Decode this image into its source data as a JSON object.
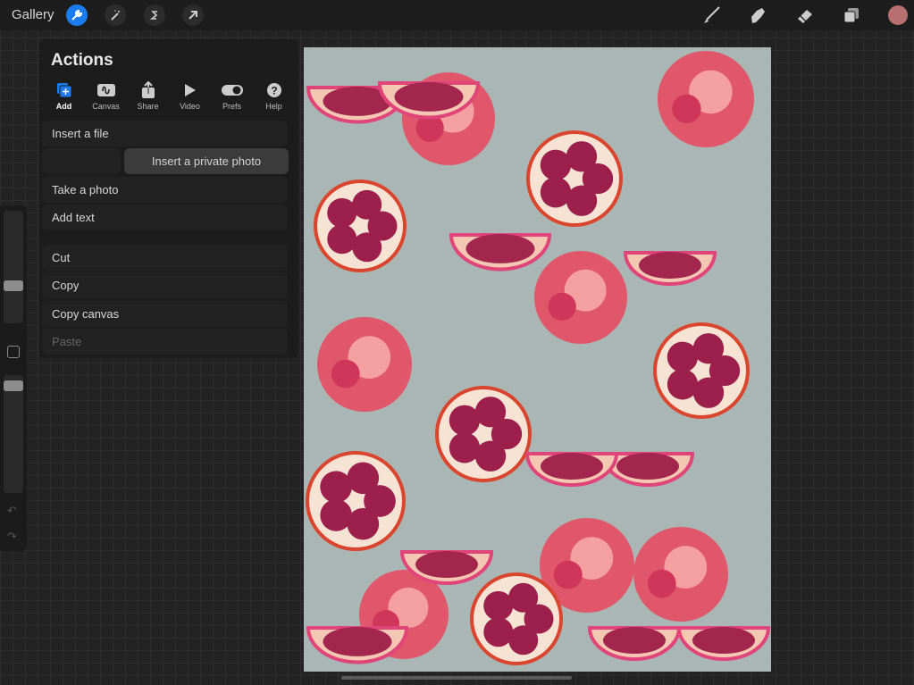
{
  "topbar": {
    "gallery": "Gallery",
    "left_tools": [
      "wrench-icon",
      "magic-wand-icon",
      "selection-icon",
      "move-arrow-icon"
    ],
    "right_tools": [
      "brush-icon",
      "smudge-icon",
      "eraser-icon",
      "layers-icon"
    ],
    "current_color": "#b86f6f",
    "accent": "#1a7cf0"
  },
  "actions": {
    "title": "Actions",
    "tabs": [
      {
        "label": "Add",
        "active": true
      },
      {
        "label": "Canvas"
      },
      {
        "label": "Share"
      },
      {
        "label": "Video"
      },
      {
        "label": "Prefs"
      },
      {
        "label": "Help"
      }
    ],
    "items": [
      "Insert a file",
      "Insert a private photo",
      "Take a photo",
      "Add text",
      "Cut",
      "Copy",
      "Copy canvas",
      "Paste"
    ]
  },
  "sidebar": {
    "brush_size": 0.33,
    "opacity": 0.91
  }
}
